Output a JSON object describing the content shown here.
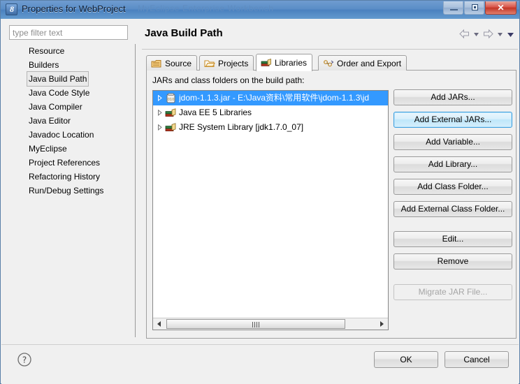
{
  "window": {
    "title": "Properties for WebProject",
    "ghost_title": "MyEclipse Enterprise Workbench",
    "icon": "properties-window-icon",
    "controls": {
      "minimize": "minimize-button",
      "maximize": "maximize-button",
      "close": "close-button",
      "close_glyph": "✕"
    }
  },
  "sidebar": {
    "filter": {
      "placeholder": "type filter text",
      "value": ""
    },
    "items": [
      {
        "label": "Resource",
        "selected": false
      },
      {
        "label": "Builders",
        "selected": false
      },
      {
        "label": "Java Build Path",
        "selected": true
      },
      {
        "label": "Java Code Style",
        "selected": false
      },
      {
        "label": "Java Compiler",
        "selected": false
      },
      {
        "label": "Java Editor",
        "selected": false
      },
      {
        "label": "Javadoc Location",
        "selected": false
      },
      {
        "label": "MyEclipse",
        "selected": false
      },
      {
        "label": "Project References",
        "selected": false
      },
      {
        "label": "Refactoring History",
        "selected": false
      },
      {
        "label": "Run/Debug Settings",
        "selected": false
      }
    ]
  },
  "main": {
    "page_title": "Java Build Path",
    "nav": {
      "back": "back-arrow",
      "back_menu": "back-dropdown",
      "forward": "forward-arrow",
      "forward_menu": "forward-dropdown",
      "menu": "view-menu"
    },
    "tabs": [
      {
        "label": "Source",
        "icon": "package-icon",
        "active": false
      },
      {
        "label": "Projects",
        "icon": "folder-icon",
        "active": false
      },
      {
        "label": "Libraries",
        "icon": "books-icon",
        "active": true
      },
      {
        "label": "Order and Export",
        "icon": "order-export-icon",
        "active": false
      }
    ],
    "pane_label": "JARs and class folders on the build path:",
    "entries": [
      {
        "label": "jdom-1.1.3.jar - E:\\Java资料\\常用软件\\jdom-1.1.3\\jd",
        "icon": "jar-icon",
        "selected": true
      },
      {
        "label": "Java EE 5 Libraries",
        "icon": "library-icon",
        "selected": false
      },
      {
        "label": "JRE System Library [jdk1.7.0_07]",
        "icon": "library-icon",
        "selected": false
      }
    ],
    "scrollbar": {
      "left_arrow": "scroll-left-arrow",
      "right_arrow": "scroll-right-arrow",
      "thumb": "horizontal-scroll-thumb"
    },
    "buttons": [
      {
        "label": "Add JARs...",
        "state": "normal"
      },
      {
        "label": "Add External JARs...",
        "state": "focused"
      },
      {
        "label": "Add Variable...",
        "state": "normal"
      },
      {
        "label": "Add Library...",
        "state": "normal"
      },
      {
        "label": "Add Class Folder...",
        "state": "normal"
      },
      {
        "label": "Add External Class Folder...",
        "state": "normal"
      },
      {
        "label": "Edit...",
        "state": "normal"
      },
      {
        "label": "Remove",
        "state": "normal"
      },
      {
        "label": "Migrate JAR File...",
        "state": "disabled"
      }
    ]
  },
  "footer": {
    "help": "help-icon",
    "ok": "OK",
    "cancel": "Cancel"
  },
  "colors": {
    "title_bar": "#5b8ec7",
    "selection": "#3399ff",
    "focus_border": "#3c9ede",
    "dialog_bg": "#f0f0f0"
  }
}
